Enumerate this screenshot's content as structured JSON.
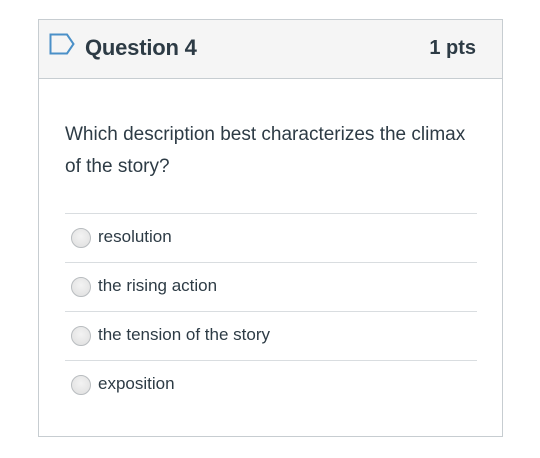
{
  "question": {
    "title": "Question 4",
    "points": "1 pts",
    "text": "Which description best characterizes the climax of the story?",
    "flag_icon": "bookmark-flag-icon"
  },
  "answers": [
    {
      "label": "resolution",
      "selected": false
    },
    {
      "label": "the rising action",
      "selected": false
    },
    {
      "label": "the tension of the story",
      "selected": false
    },
    {
      "label": "exposition",
      "selected": false
    }
  ],
  "colors": {
    "text": "#2d3b45",
    "border": "#c7cdd1",
    "header_bg": "#f5f5f5",
    "flag_stroke": "#4a90c8"
  }
}
